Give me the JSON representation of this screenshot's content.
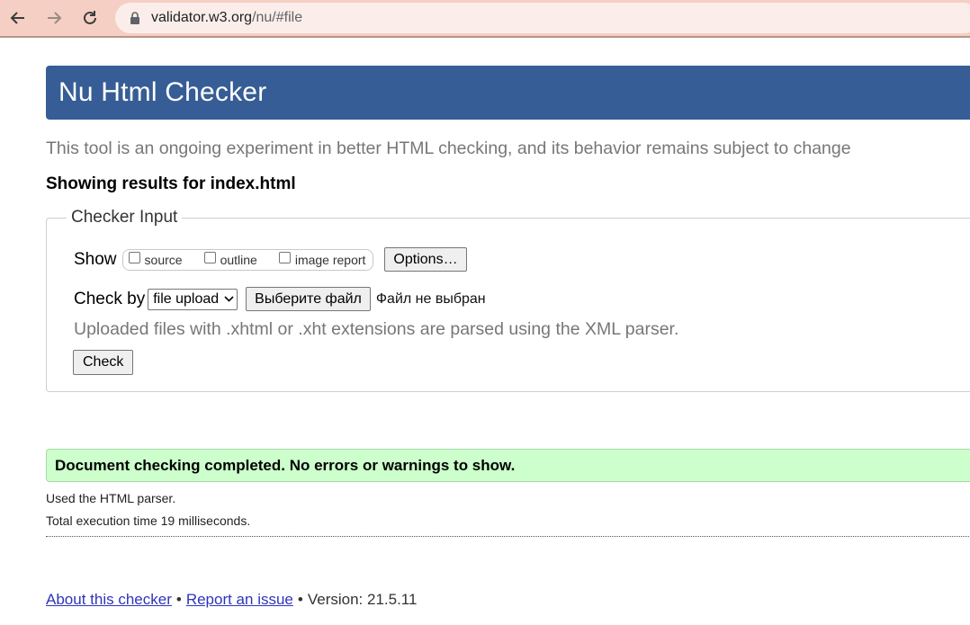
{
  "browser": {
    "url_host": "validator.w3.org",
    "url_path": "/nu/#file"
  },
  "header": {
    "title": "Nu Html Checker"
  },
  "subtitle": "This tool is an ongoing experiment in better HTML checking, and its behavior remains subject to change",
  "results_for": "Showing results for index.html",
  "checker_input": {
    "legend": "Checker Input",
    "show_label": "Show",
    "show_options": [
      {
        "label": "source",
        "checked": false
      },
      {
        "label": "outline",
        "checked": false
      },
      {
        "label": "image report",
        "checked": false
      }
    ],
    "options_button": "Options…",
    "check_by_label": "Check by",
    "check_by_selected": "file upload",
    "file_button": "Выберите файл",
    "file_status": "Файл не выбран",
    "xml_note": "Uploaded files with .xhtml or .xht extensions are parsed using the XML parser.",
    "check_button": "Check"
  },
  "result": {
    "message": "Document checking completed. No errors or warnings to show.",
    "parser_note": "Used the HTML parser.",
    "execution_time": "Total execution time 19 milliseconds."
  },
  "footer": {
    "about_link": "About this checker",
    "separator": "•",
    "report_link": "Report an issue",
    "version": "Version: 21.5.11"
  },
  "colors": {
    "header_bg": "#365d95",
    "success_bg": "#ccffcc",
    "browser_bar": "#f5cfc4",
    "link": "#2f35b9"
  }
}
